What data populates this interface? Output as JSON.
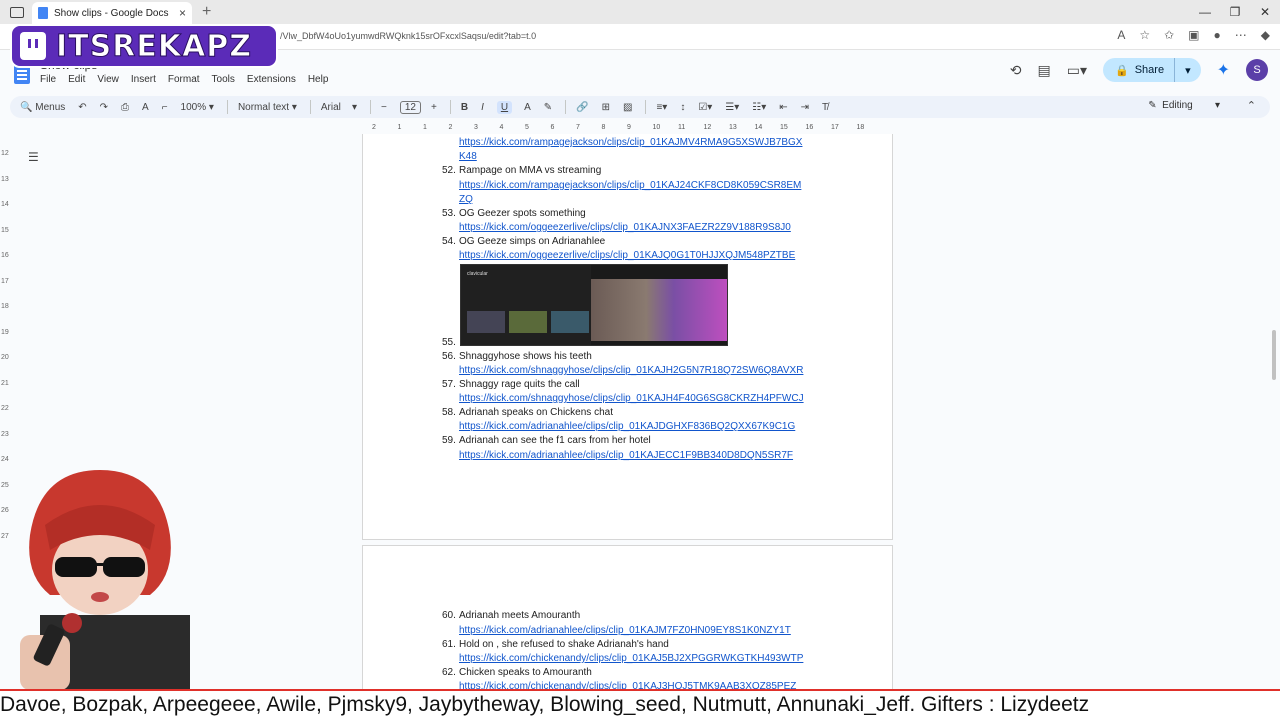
{
  "browser": {
    "tab_title": "Show clips - Google Docs",
    "url_fragment": "/Vlw_DbfW4oUo1yumwdRWQknk15srOFxcxlSaqsu/edit?tab=t.0"
  },
  "doc": {
    "title": "Show clips",
    "menu": [
      "File",
      "Edit",
      "View",
      "Insert",
      "Format",
      "Tools",
      "Extensions",
      "Help"
    ],
    "share_label": "Share",
    "avatar_letter": "S",
    "editing_label": "Editing"
  },
  "toolbar": {
    "menus_label": "Menus",
    "zoom": "100%",
    "style": "Normal text",
    "font": "Arial",
    "font_size": "12"
  },
  "ruler_numbers": [
    "2",
    "1",
    "1",
    "2",
    "3",
    "4",
    "5",
    "6",
    "7",
    "8",
    "9",
    "10",
    "11",
    "12",
    "13",
    "14",
    "15",
    "16",
    "17",
    "18"
  ],
  "vruler_numbers": [
    "12",
    "13",
    "14",
    "15",
    "16",
    "17",
    "18",
    "19",
    "20",
    "21",
    "22",
    "23",
    "24",
    "25",
    "26",
    "27"
  ],
  "page1_lines": [
    {
      "num": "",
      "text": "https://kick.com/rampagejackson/clips/clip_01KAJMV4RMA9G5XSWJB7BGX",
      "link": true
    },
    {
      "num": "",
      "text": "K48",
      "link": true
    },
    {
      "num": "52.",
      "text": "Rampage on MMA vs streaming",
      "link": false
    },
    {
      "num": "",
      "text": "https://kick.com/rampagejackson/clips/clip_01KAJ24CKF8CD8K059CSR8EM",
      "link": true
    },
    {
      "num": "",
      "text": "ZQ",
      "link": true
    },
    {
      "num": "53.",
      "text": "OG Geezer spots something",
      "link": false
    },
    {
      "num": "",
      "text": "https://kick.com/oggeezerlive/clips/clip_01KAJNX3FAEZR2Z9V188R9S8J0",
      "link": true
    },
    {
      "num": "54.",
      "text": "OG Geeze simps on Adrianahlee",
      "link": false
    },
    {
      "num": "",
      "text": "https://kick.com/oggeezerlive/clips/clip_01KAJQ0G1T0HJJXQJM548PZTBE",
      "link": true
    }
  ],
  "image_item_num": "55.",
  "page1_lines_b": [
    {
      "num": "56.",
      "text": "Shnaggyhose shows his teeth",
      "link": false
    },
    {
      "num": "",
      "text": "https://kick.com/shnaggyhose/clips/clip_01KAJH2G5N7R18Q72SW6Q8AVXR",
      "link": true
    },
    {
      "num": "57.",
      "text": "Shnaggy rage quits the call",
      "link": false
    },
    {
      "num": "",
      "text": "https://kick.com/shnaggyhose/clips/clip_01KAJH4F40G6SG8CKRZH4PFWCJ",
      "link": true
    },
    {
      "num": "58.",
      "text": "Adrianah speaks on Chickens chat",
      "link": false
    },
    {
      "num": "",
      "text": "https://kick.com/adrianahlee/clips/clip_01KAJDGHXF836BQ2QXX67K9C1G",
      "link": true
    },
    {
      "num": "59.",
      "text": "Adrianah can see the f1 cars from her hotel",
      "link": false
    },
    {
      "num": "",
      "text": "https://kick.com/adrianahlee/clips/clip_01KAJECC1F9BB340D8DQN5SR7F",
      "link": true
    }
  ],
  "page2_lines": [
    {
      "num": "60.",
      "text": "Adrianah meets Amouranth",
      "link": false
    },
    {
      "num": "",
      "text": "https://kick.com/adrianahlee/clips/clip_01KAJM7FZ0HN09EY8S1K0NZY1T",
      "link": true
    },
    {
      "num": "61.",
      "text": "Hold on , she refused to shake Adrianah's hand",
      "link": false
    },
    {
      "num": "",
      "text": "https://kick.com/chickenandy/clips/clip_01KAJ5BJ2XPGGRWKGTKH493WTP",
      "link": true
    },
    {
      "num": "62.",
      "text": "Chicken speaks to Amouranth",
      "link": false
    },
    {
      "num": "",
      "text": "https://kick.com/chickenandy/clips/clip_01KAJ3HQJ5TMK9AAB3XQZ85PEZ",
      "link": true
    }
  ],
  "thumb_header": "clavicular",
  "overlay": {
    "logo_text": "ITSREKAPZ",
    "ticker": "Davoe, Bozpak, Arpeegeee, Awile, Pjmsky9, Jaybytheway, Blowing_seed, Nutmutt, Annunaki_Jeff. Gifters : Lizydeetz"
  }
}
